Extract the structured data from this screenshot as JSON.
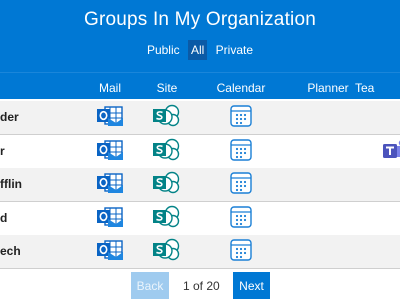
{
  "header": {
    "title": "Groups In My Organization"
  },
  "filters": [
    {
      "label": "Public"
    },
    {
      "label": "All"
    },
    {
      "label": "Private"
    }
  ],
  "columns": {
    "mail": "Mail",
    "site": "Site",
    "calendar": "Calendar",
    "planner": "Planner",
    "teams": "Tea"
  },
  "rows": [
    {
      "name": "der",
      "mail_icon": "outlook-mail-icon",
      "site_icon": "sharepoint-site-icon",
      "calendar_icon": "calendar-icon",
      "teams": false
    },
    {
      "name": "r",
      "mail_icon": "outlook-mail-icon",
      "site_icon": "sharepoint-site-icon",
      "calendar_icon": "calendar-icon",
      "teams": true
    },
    {
      "name": "fflin",
      "mail_icon": "outlook-mail-icon",
      "site_icon": "sharepoint-site-icon",
      "calendar_icon": "calendar-icon",
      "teams": false
    },
    {
      "name": "d",
      "mail_icon": "outlook-mail-icon",
      "site_icon": "sharepoint-site-icon",
      "calendar_icon": "calendar-icon",
      "teams": false
    },
    {
      "name": "ech",
      "mail_icon": "outlook-mail-icon",
      "site_icon": "sharepoint-site-icon",
      "calendar_icon": "calendar-icon",
      "teams": false
    }
  ],
  "pagination": {
    "back": "Back",
    "info": "1 of 20",
    "next": "Next"
  },
  "colors": {
    "header_bg": "#0078d4",
    "active_filter": "#0b5aa6",
    "row_odd": "#f2f2f2",
    "row_even": "#ffffff",
    "sharepoint": "#038387",
    "teams": "#5558af"
  }
}
